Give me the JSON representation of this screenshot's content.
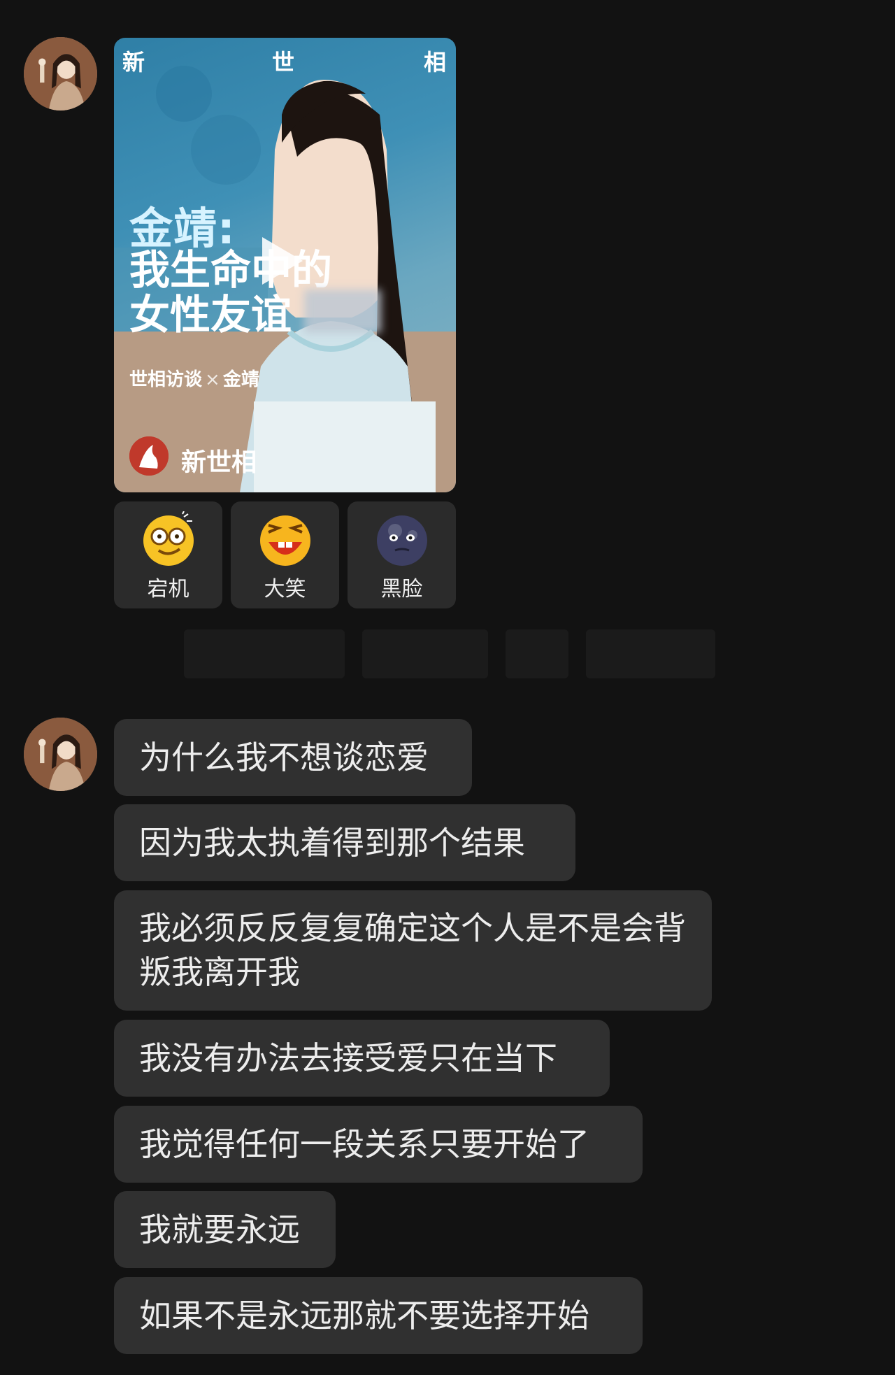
{
  "video_card": {
    "brand_top": [
      "新",
      "世",
      "相"
    ],
    "title_line1": "金靖:",
    "title_line2": "我生命中的",
    "title_line3": "女性友谊",
    "subtitle_left": "世相访谈",
    "subtitle_sep": "×",
    "subtitle_right": "金靖",
    "brand_name": "新世相"
  },
  "reactions": [
    {
      "icon": "dazed-face-icon",
      "label": "宕机"
    },
    {
      "icon": "laughing-face-icon",
      "label": "大笑"
    },
    {
      "icon": "dark-face-icon",
      "label": "黑脸"
    }
  ],
  "messages": [
    "为什么我不想谈恋爱",
    "因为我太执着得到那个结果",
    "我必须反反复复确定这个人是不是会背叛我离开我",
    "我没有办法去接受爱只在当下",
    "我觉得任何一段关系只要开始了",
    "我就要永远",
    "如果不是永远那就不要选择开始"
  ],
  "colors": {
    "background": "#121212",
    "bubble": "#303030",
    "text": "#ededed"
  }
}
